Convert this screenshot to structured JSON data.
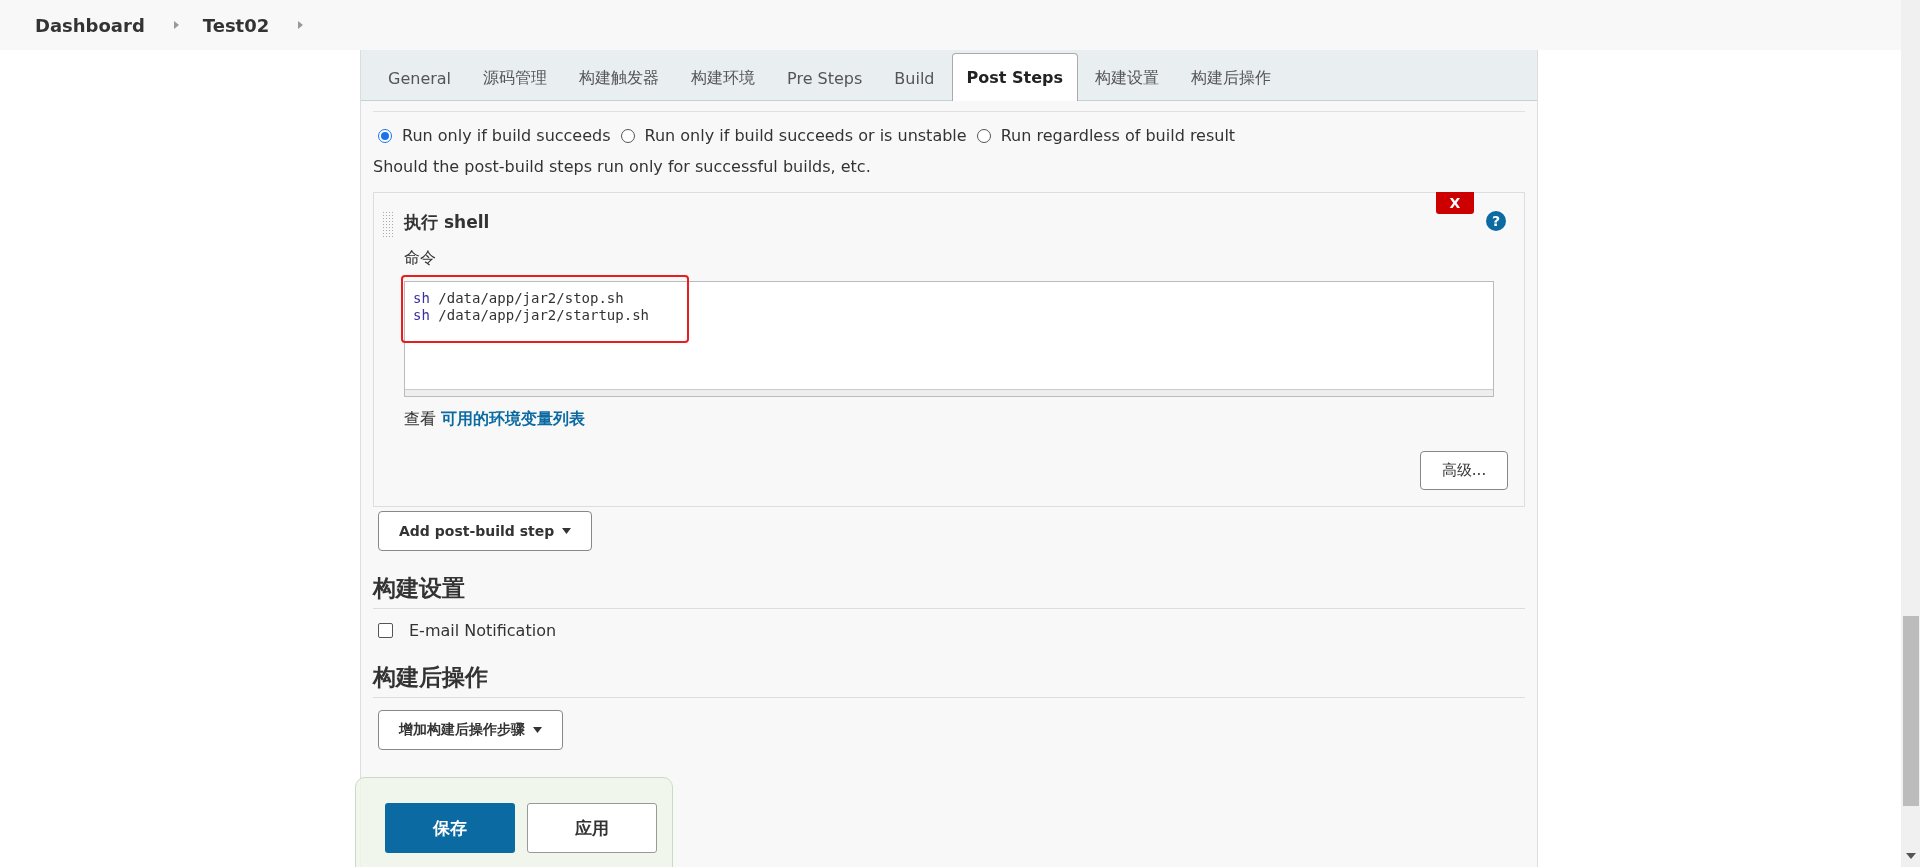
{
  "breadcrumbs": [
    "Dashboard",
    "Test02"
  ],
  "tabs": [
    {
      "label": "General",
      "selected": false
    },
    {
      "label": "源码管理",
      "selected": false
    },
    {
      "label": "构建触发器",
      "selected": false
    },
    {
      "label": "构建环境",
      "selected": false
    },
    {
      "label": "Pre Steps",
      "selected": false
    },
    {
      "label": "Build",
      "selected": false
    },
    {
      "label": "Post Steps",
      "selected": true
    },
    {
      "label": "构建设置",
      "selected": false
    },
    {
      "label": "构建后操作",
      "selected": false
    }
  ],
  "run_condition": {
    "options": [
      {
        "label": "Run only if build succeeds",
        "selected": true
      },
      {
        "label": "Run only if build succeeds or is unstable",
        "selected": false
      },
      {
        "label": "Run regardless of build result",
        "selected": false
      }
    ],
    "description": "Should the post-build steps run only for successful builds, etc."
  },
  "shell_step": {
    "title": "执行 shell",
    "delete_label": "X",
    "help": "?",
    "field_label": "命令",
    "command_lines": [
      {
        "keyword": "sh",
        "rest": " /data/app/jar2/stop.sh"
      },
      {
        "keyword": "sh",
        "rest": " /data/app/jar2/startup.sh"
      }
    ],
    "env_prefix": "查看",
    "env_link": "可用的环境变量列表",
    "advanced_button": "高级..."
  },
  "add_post_build_step": "Add post-build step",
  "build_settings": {
    "heading": "构建设置",
    "email_notification": {
      "label": "E-mail Notification",
      "checked": false
    }
  },
  "post_build_actions": {
    "heading": "构建后操作",
    "add_button": "增加构建后操作步骤"
  },
  "footer": {
    "save": "保存",
    "apply": "应用"
  }
}
